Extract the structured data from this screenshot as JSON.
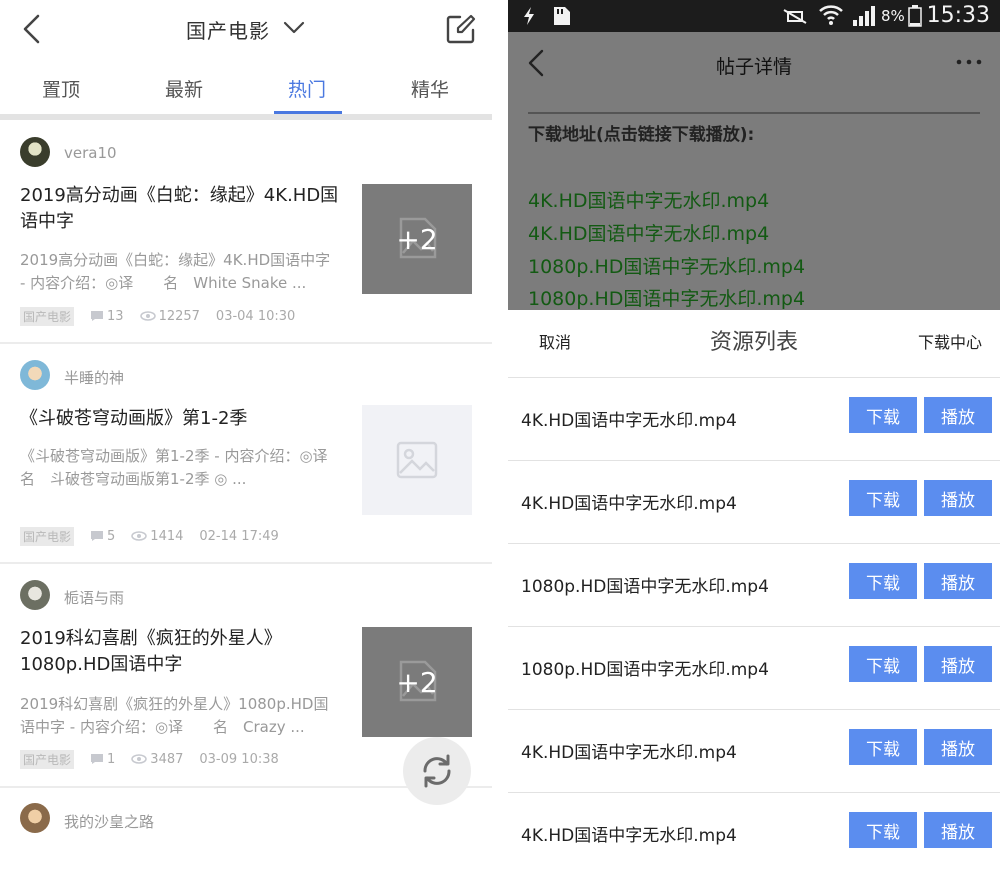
{
  "left": {
    "header": {
      "title": "国产电影"
    },
    "tabs": [
      {
        "label": "置顶"
      },
      {
        "label": "最新"
      },
      {
        "label": "热门"
      },
      {
        "label": "精华"
      }
    ],
    "active_tab": "热门",
    "posts": [
      {
        "user": "vera10",
        "title": "2019高分动画《白蛇：缘起》4K.HD国语中字",
        "desc": "2019高分动画《白蛇：缘起》4K.HD国语中字 - 内容介绍：◎译　　名　White Snake ...",
        "tag": "国产电影",
        "comments": "13",
        "views": "12257",
        "date": "03-04 10:30",
        "thumb_text": "+2"
      },
      {
        "user": "半睡的神",
        "title": "《斗破苍穹动画版》第1-2季",
        "desc": "《斗破苍穹动画版》第1-2季 - 内容介绍：◎译　　名　斗破苍穹动画版第1-2季 ◎ ...",
        "tag": "国产电影",
        "comments": "5",
        "views": "1414",
        "date": "02-14 17:49",
        "thumb_text": ""
      },
      {
        "user": "栀语与雨",
        "title": "2019科幻喜剧《疯狂的外星人》1080p.HD国语中字",
        "desc": "2019科幻喜剧《疯狂的外星人》1080p.HD国语中字 - 内容介绍：◎译　　名　Crazy ...",
        "tag": "国产电影",
        "comments": "1",
        "views": "3487",
        "date": "03-09 10:38",
        "thumb_text": "+2"
      },
      {
        "user": "我的沙皇之路"
      }
    ]
  },
  "right": {
    "status": {
      "battery": "8%",
      "time": "15:33"
    },
    "header": {
      "title": "帖子详情"
    },
    "download_heading": "下载地址(点击链接下载播放):",
    "links": [
      "4K.HD国语中字无水印.mp4",
      "4K.HD国语中字无水印.mp4",
      "1080p.HD国语中字无水印.mp4",
      "1080p.HD国语中字无水印.mp4"
    ],
    "sheet": {
      "cancel": "取消",
      "title": "资源列表",
      "download_center": "下载中心",
      "download_label": "下载",
      "play_label": "播放",
      "items": [
        "4K.HD国语中字无水印.mp4",
        "4K.HD国语中字无水印.mp4",
        "1080p.HD国语中字无水印.mp4",
        "1080p.HD国语中字无水印.mp4",
        "4K.HD国语中字无水印.mp4",
        "4K.HD国语中字无水印.mp4"
      ]
    }
  },
  "colors": {
    "accent": "#4a78e0",
    "button": "#5b8def",
    "link_green": "#135a13",
    "overlay": "#7c7c7c"
  }
}
